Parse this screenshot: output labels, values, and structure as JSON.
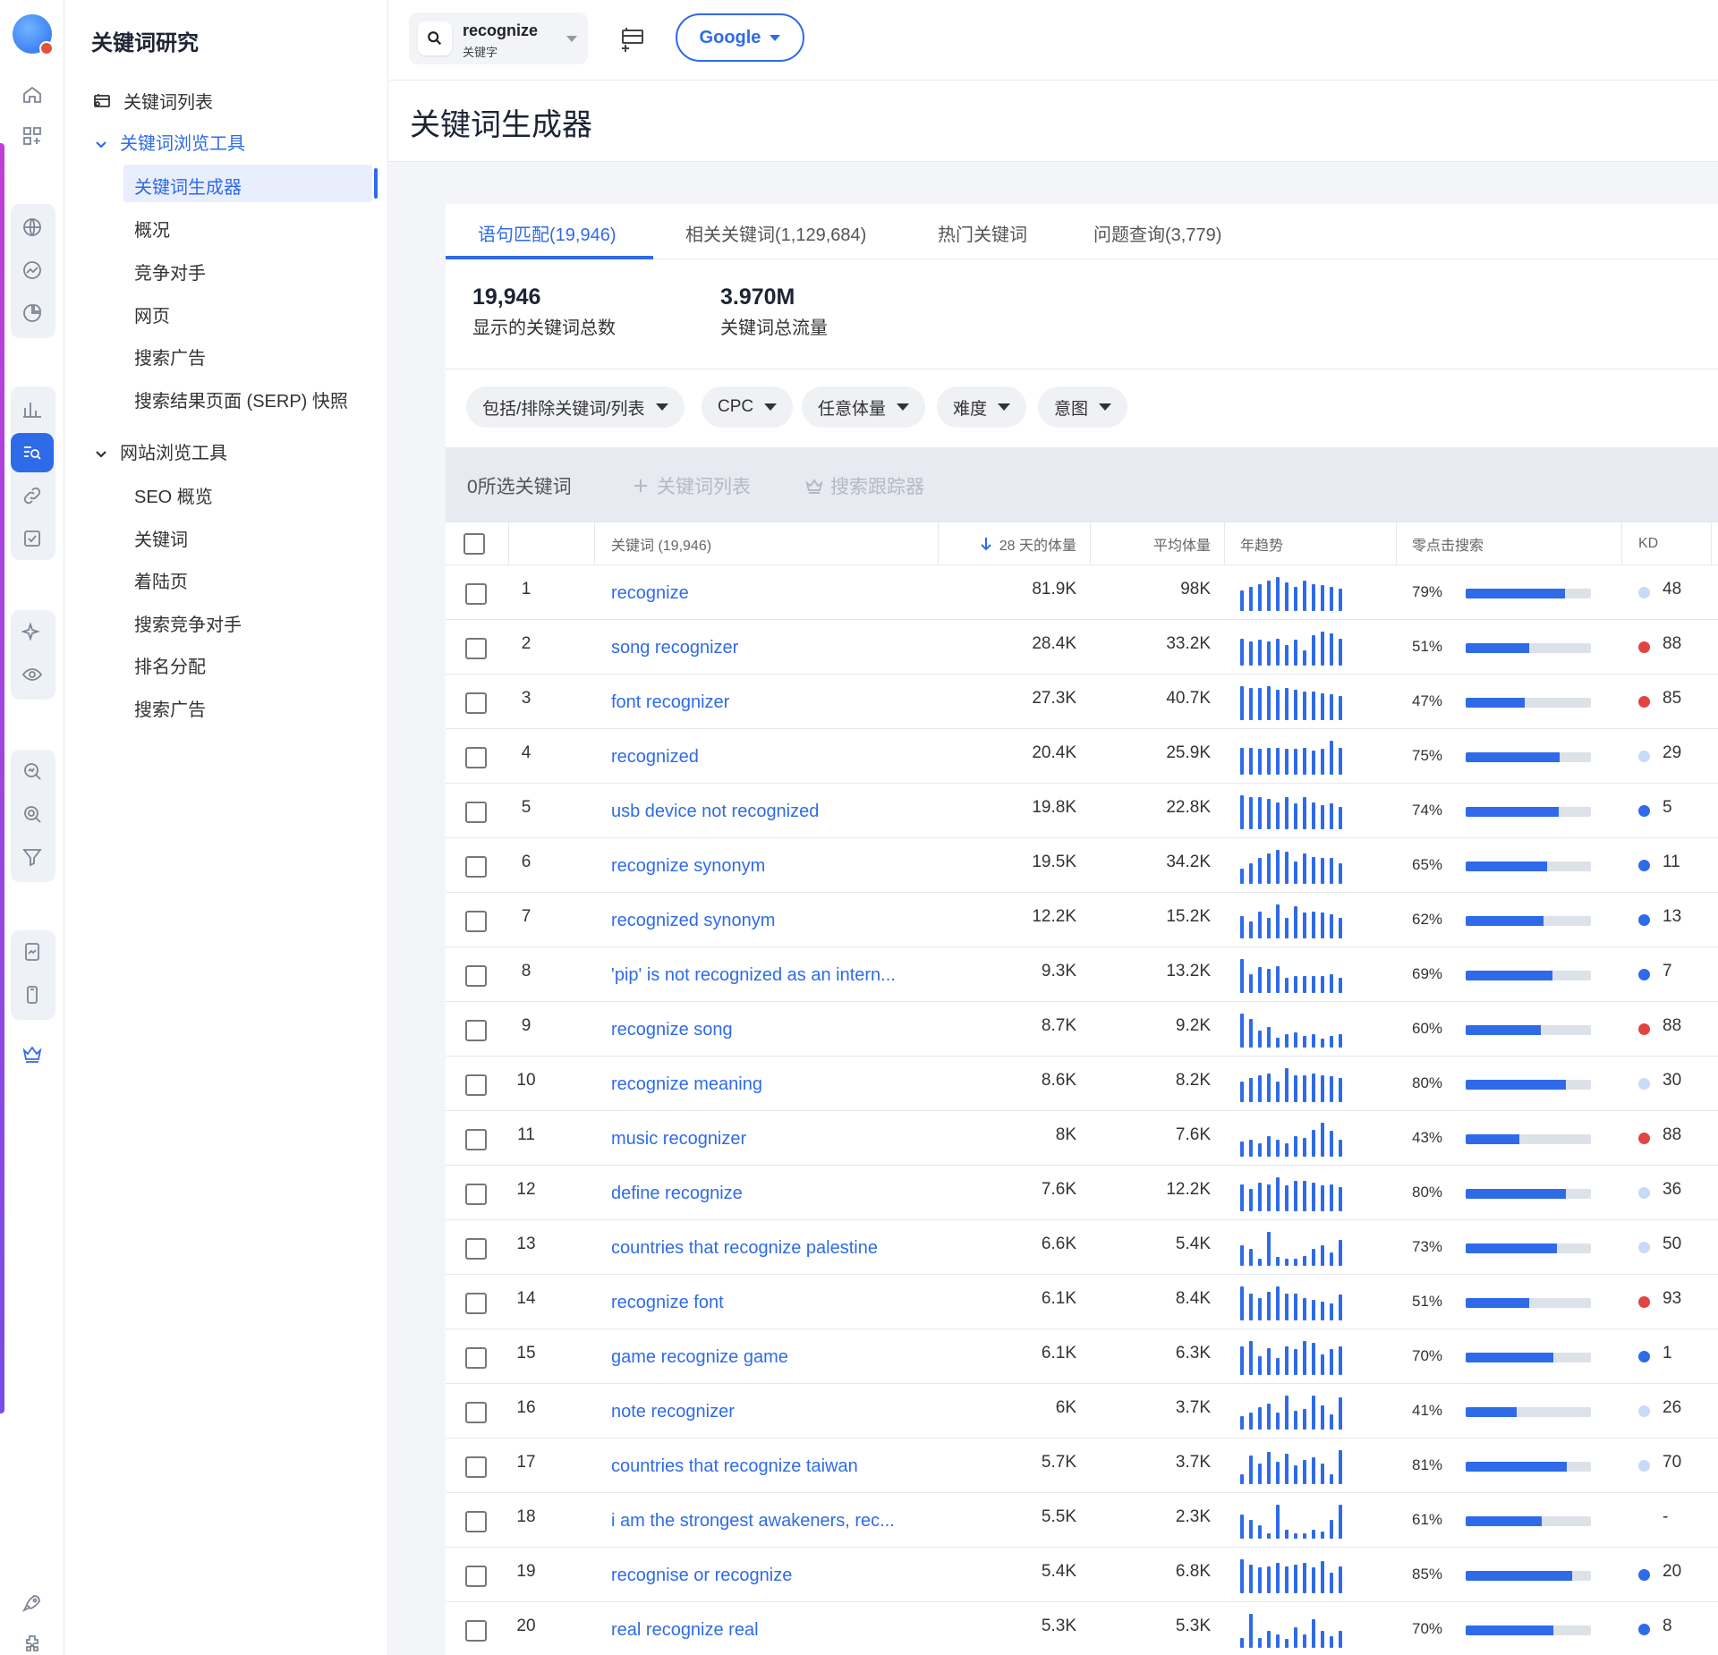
{
  "colors": {
    "accent": "#2f6be8",
    "kd_hard": "#e04444",
    "kd_mid": "#2f6be8",
    "kd_easy": "#c7dbf7"
  },
  "nav": {
    "title": "关键词研究",
    "keyword_list": "关键词列表",
    "explorer": "关键词浏览工具",
    "explorer_items": [
      "关键词生成器",
      "概况",
      "竞争对手",
      "网页",
      "搜索广告",
      "搜索结果页面 (SERP) 快照"
    ],
    "site_explorer": "网站浏览工具",
    "site_items": [
      "SEO 概览",
      "关键词",
      "着陆页",
      "搜索竞争对手",
      "排名分配",
      "搜索广告"
    ]
  },
  "topbar": {
    "search_term": "recognize",
    "search_sub": "关键字",
    "engine": "Google"
  },
  "page": {
    "title": "关键词生成器"
  },
  "tabs": [
    "语句匹配(19,946)",
    "相关关键词(1,129,684)",
    "热门关键词",
    "问题查询(3,779)"
  ],
  "stats": [
    {
      "value": "19,946",
      "label": "显示的关键词总数"
    },
    {
      "value": "3.970M",
      "label": "关键词总流量"
    }
  ],
  "filters": [
    "包括/排除关键词/列表",
    "CPC",
    "任意体量",
    "难度",
    "意图"
  ],
  "selection": {
    "count_text": "0所选关键词",
    "add_list": "关键词列表",
    "tracker": "搜索跟踪器"
  },
  "table": {
    "headers": {
      "keyword": "关键词 (19,946)",
      "vol28": "28 天的体量",
      "avg": "平均体量",
      "trend": "年趋势",
      "zero": "零点击搜索",
      "kd": "KD"
    },
    "rows": [
      {
        "n": "1",
        "kw": "recognize",
        "v28": "81.9K",
        "avg": "98K",
        "zero": "79%",
        "zf": 0.79,
        "kd": "48",
        "kdc": "easy",
        "trend": [
          0.6,
          0.7,
          0.8,
          0.9,
          1.0,
          0.85,
          0.7,
          0.9,
          0.8,
          0.75,
          0.7,
          0.65
        ]
      },
      {
        "n": "2",
        "kw": "song recognizer",
        "v28": "28.4K",
        "avg": "33.2K",
        "zero": "51%",
        "zf": 0.51,
        "kd": "88",
        "kdc": "hard",
        "trend": [
          0.8,
          0.7,
          0.75,
          0.7,
          0.8,
          0.6,
          0.75,
          0.45,
          0.9,
          1.0,
          0.95,
          0.8
        ]
      },
      {
        "n": "3",
        "kw": "font recognizer",
        "v28": "27.3K",
        "avg": "40.7K",
        "zero": "47%",
        "zf": 0.47,
        "kd": "85",
        "kdc": "hard",
        "trend": [
          1.0,
          0.95,
          0.95,
          1.0,
          0.9,
          0.95,
          0.9,
          0.85,
          0.85,
          0.8,
          0.75,
          0.7
        ]
      },
      {
        "n": "4",
        "kw": "recognized",
        "v28": "20.4K",
        "avg": "25.9K",
        "zero": "75%",
        "zf": 0.75,
        "kd": "29",
        "kdc": "easy",
        "trend": [
          0.8,
          0.8,
          0.75,
          0.8,
          0.8,
          0.75,
          0.75,
          0.8,
          0.7,
          0.75,
          1.0,
          0.8
        ]
      },
      {
        "n": "5",
        "kw": "usb device not recognized",
        "v28": "19.8K",
        "avg": "22.8K",
        "zero": "74%",
        "zf": 0.74,
        "kd": "5",
        "kdc": "mid",
        "trend": [
          1.0,
          0.95,
          0.95,
          0.9,
          0.8,
          0.95,
          0.75,
          0.95,
          0.8,
          0.7,
          0.75,
          0.65
        ]
      },
      {
        "n": "6",
        "kw": "recognize synonym",
        "v28": "19.5K",
        "avg": "34.2K",
        "zero": "65%",
        "zf": 0.65,
        "kd": "11",
        "kdc": "mid",
        "trend": [
          0.45,
          0.6,
          0.75,
          0.9,
          1.0,
          0.95,
          0.65,
          0.9,
          0.8,
          0.75,
          0.75,
          0.6
        ]
      },
      {
        "n": "7",
        "kw": "recognized synonym",
        "v28": "12.2K",
        "avg": "15.2K",
        "zero": "62%",
        "zf": 0.62,
        "kd": "13",
        "kdc": "mid",
        "trend": [
          0.65,
          0.5,
          0.8,
          0.6,
          1.0,
          0.6,
          0.95,
          0.75,
          0.8,
          0.75,
          0.7,
          0.6
        ]
      },
      {
        "n": "8",
        "kw": "'pip' is not recognized as an intern...",
        "v28": "9.3K",
        "avg": "13.2K",
        "zero": "69%",
        "zf": 0.69,
        "kd": "7",
        "kdc": "mid",
        "trend": [
          1.0,
          0.55,
          0.75,
          0.7,
          0.8,
          0.45,
          0.5,
          0.5,
          0.5,
          0.5,
          0.55,
          0.45
        ]
      },
      {
        "n": "9",
        "kw": "recognize song",
        "v28": "8.7K",
        "avg": "9.2K",
        "zero": "60%",
        "zf": 0.6,
        "kd": "88",
        "kdc": "hard",
        "trend": [
          1.0,
          0.85,
          0.5,
          0.6,
          0.3,
          0.4,
          0.45,
          0.35,
          0.4,
          0.25,
          0.35,
          0.4
        ]
      },
      {
        "n": "10",
        "kw": "recognize meaning",
        "v28": "8.6K",
        "avg": "8.2K",
        "zero": "80%",
        "zf": 0.8,
        "kd": "30",
        "kdc": "easy",
        "trend": [
          0.6,
          0.7,
          0.8,
          0.85,
          0.6,
          1.0,
          0.8,
          0.8,
          0.85,
          0.8,
          0.75,
          0.7
        ]
      },
      {
        "n": "11",
        "kw": "music recognizer",
        "v28": "8K",
        "avg": "7.6K",
        "zero": "43%",
        "zf": 0.43,
        "kd": "88",
        "kdc": "hard",
        "trend": [
          0.45,
          0.5,
          0.4,
          0.6,
          0.5,
          0.4,
          0.6,
          0.55,
          0.8,
          1.0,
          0.75,
          0.5
        ]
      },
      {
        "n": "12",
        "kw": "define recognize",
        "v28": "7.6K",
        "avg": "12.2K",
        "zero": "80%",
        "zf": 0.8,
        "kd": "36",
        "kdc": "easy",
        "trend": [
          0.8,
          0.65,
          0.85,
          0.8,
          1.0,
          0.75,
          0.9,
          0.9,
          0.85,
          0.75,
          0.8,
          0.7
        ]
      },
      {
        "n": "13",
        "kw": "countries that recognize palestine",
        "v28": "6.6K",
        "avg": "5.4K",
        "zero": "73%",
        "zf": 0.73,
        "kd": "50",
        "kdc": "easy",
        "trend": [
          0.6,
          0.5,
          0.2,
          1.0,
          0.25,
          0.2,
          0.2,
          0.3,
          0.5,
          0.6,
          0.4,
          0.75
        ]
      },
      {
        "n": "14",
        "kw": "recognize font",
        "v28": "6.1K",
        "avg": "8.4K",
        "zero": "51%",
        "zf": 0.51,
        "kd": "93",
        "kdc": "hard",
        "trend": [
          1.0,
          0.8,
          0.65,
          0.85,
          1.0,
          0.8,
          0.8,
          0.65,
          0.6,
          0.55,
          0.5,
          0.75
        ]
      },
      {
        "n": "15",
        "kw": "game recognize game",
        "v28": "6.1K",
        "avg": "6.3K",
        "zero": "70%",
        "zf": 0.7,
        "kd": "1",
        "kdc": "mid",
        "trend": [
          0.85,
          1.0,
          0.55,
          0.8,
          0.5,
          0.85,
          0.75,
          1.0,
          0.95,
          0.6,
          0.75,
          0.85
        ]
      },
      {
        "n": "16",
        "kw": "note recognizer",
        "v28": "6K",
        "avg": "3.7K",
        "zero": "41%",
        "zf": 0.41,
        "kd": "26",
        "kdc": "easy",
        "trend": [
          0.4,
          0.5,
          0.65,
          0.75,
          0.5,
          1.0,
          0.55,
          0.6,
          1.0,
          0.7,
          0.45,
          0.95
        ]
      },
      {
        "n": "17",
        "kw": "countries that recognize taiwan",
        "v28": "5.7K",
        "avg": "3.7K",
        "zero": "81%",
        "zf": 0.81,
        "kd": "70",
        "kdc": "easy",
        "trend": [
          0.3,
          0.85,
          0.6,
          0.95,
          0.65,
          0.9,
          0.55,
          0.7,
          0.8,
          0.6,
          0.3,
          1.0
        ]
      },
      {
        "n": "18",
        "kw": "i am the strongest awakeners, rec...",
        "v28": "5.5K",
        "avg": "2.3K",
        "zero": "61%",
        "zf": 0.61,
        "kd": "-",
        "kdc": "none",
        "trend": [
          0.7,
          0.55,
          0.4,
          0.15,
          1.0,
          0.25,
          0.15,
          0.15,
          0.25,
          0.2,
          0.55,
          1.0
        ]
      },
      {
        "n": "19",
        "kw": "recognise or recognize",
        "v28": "5.4K",
        "avg": "6.8K",
        "zero": "85%",
        "zf": 0.85,
        "kd": "20",
        "kdc": "mid",
        "trend": [
          1.0,
          0.85,
          0.75,
          0.8,
          0.9,
          0.8,
          0.85,
          0.9,
          0.75,
          0.95,
          0.6,
          0.8
        ]
      },
      {
        "n": "20",
        "kw": "real recognize real",
        "v28": "5.3K",
        "avg": "5.3K",
        "zero": "70%",
        "zf": 0.7,
        "kd": "8",
        "kdc": "mid",
        "trend": [
          0.3,
          1.0,
          0.3,
          0.5,
          0.4,
          0.25,
          0.6,
          0.4,
          0.85,
          0.5,
          0.35,
          0.5
        ]
      }
    ]
  }
}
